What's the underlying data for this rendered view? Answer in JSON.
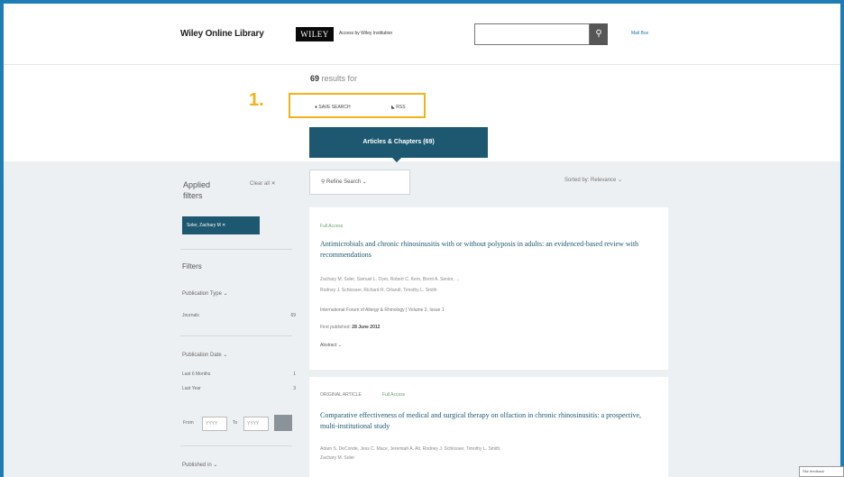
{
  "header": {
    "site_name": "Wiley Online Library",
    "logo_text": "WILEY",
    "access_text": "Access by Wiley Institution",
    "search_placeholder": "",
    "menu_link": "Mail Box"
  },
  "results": {
    "count": "69",
    "count_suffix": "results for",
    "step_label": "1.",
    "query_text": "SAVE SEARCH",
    "rss_text": "RSS"
  },
  "tab": {
    "label": "Articles & Chapters (69)"
  },
  "sidebar": {
    "applied_title_1": "Applied",
    "applied_title_2": "filters",
    "clear_all": "Clear all ✕",
    "chip": "Soler, Zachary M ✕",
    "filters_title": "Filters",
    "publication_type": "Publication Type ⌄",
    "type_rows": [
      {
        "label": "Journals",
        "count": "69"
      }
    ],
    "publication_date": "Publication Date ⌄",
    "date_rows": [
      {
        "label": "Last 6 Months",
        "count": "1"
      },
      {
        "label": "Last Year",
        "count": "3"
      }
    ],
    "from_label": "From",
    "to_label": "To",
    "from_placeholder": "YYYY",
    "to_placeholder": "YYYY",
    "published_in": "Published in ⌄"
  },
  "toolbar": {
    "filter_label": "⚲  Refine Search  ⌄",
    "sort_label": "Sorted by: Relevance ⌄"
  },
  "cards": [
    {
      "tag": "Full Access",
      "title": "Antimicrobials and chronic rhinosinusitis with or without polyposis in adults: an evidenced-based review with recommendations",
      "authors_1": "Zachary M. Soler, Samuel L. Oyer, Robert C. Kern, Brent A. Senior, ...",
      "authors_2": "Rodney J. Schlosser, Richard R. Orlandi, Timothy L. Smith",
      "journal": "International Forum of Allergy & Rhinology | Volume 2, Issue 1",
      "published_label": "First published: ",
      "published_date": "28 June 2012",
      "abstract": "Abstract ⌄"
    },
    {
      "tag": "ORIGINAL ARTICLE",
      "tag2": "Full Access",
      "title": "Comparative effectiveness of medical and surgical therapy on olfaction in chronic rhinosinusitis: a prospective, multi-institutional study",
      "authors_1": "Adam S. DeConde, Jess C. Mace, Jeremiah A. Alt, Rodney J. Schlosser, Timothy L. Smith,",
      "authors_2": "Zachary M. Soler"
    }
  ],
  "feedback": "Site feedback",
  "colors": {
    "accent": "#1d5870",
    "highlight": "#f0b318",
    "frame": "#1e7db5"
  }
}
